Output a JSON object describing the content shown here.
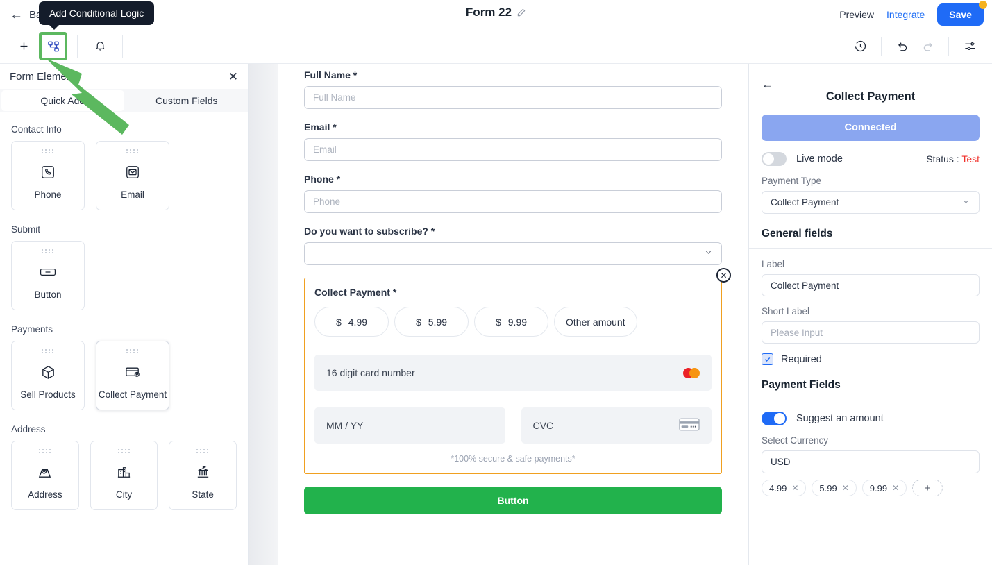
{
  "header": {
    "back_label": "Back",
    "form_title": "Form 22",
    "pencil_icon": "pencil-icon",
    "preview_label": "Preview",
    "integrate_label": "Integrate",
    "save_label": "Save",
    "save_badge_color": "#f5b220",
    "save_button_color": "#1f6bf6",
    "integrate_link_color": "#1a6bf5"
  },
  "toolbar": {
    "add_icon": "plus-icon",
    "conditional_logic_icon": "conditional-logic-icon",
    "notification_icon": "bell-icon",
    "history_icon": "history-clock-icon",
    "undo_icon": "undo-icon",
    "redo_icon": "redo-icon",
    "settings_icon": "sliders-settings-icon",
    "highlight_color": "#5cb85f"
  },
  "tooltip": {
    "text": "Add Conditional Logic"
  },
  "left_panel": {
    "title": "Form Elements",
    "close_icon": "close-icon",
    "tabs": [
      {
        "label": "Quick Add",
        "active": true
      },
      {
        "label": "Custom Fields",
        "active": false
      }
    ],
    "groups": [
      {
        "title": "Contact Info",
        "items": [
          {
            "label": "Phone",
            "icon": "phone-icon"
          },
          {
            "label": "Email",
            "icon": "envelope-icon"
          }
        ]
      },
      {
        "title": "Submit",
        "items": [
          {
            "label": "Button",
            "icon": "button-icon"
          }
        ]
      },
      {
        "title": "Payments",
        "items": [
          {
            "label": "Sell Products",
            "icon": "box-package-icon"
          },
          {
            "label": "Collect Payment",
            "icon": "credit-card-shield-icon",
            "selected": true
          }
        ]
      },
      {
        "title": "Address",
        "items": [
          {
            "label": "Address",
            "icon": "map-pin-icon"
          },
          {
            "label": "City",
            "icon": "city-building-icon"
          },
          {
            "label": "State",
            "icon": "bank-landmark-icon"
          }
        ]
      }
    ]
  },
  "canvas": {
    "fields": [
      {
        "label": "Full Name *",
        "placeholder": "Full Name",
        "type": "text"
      },
      {
        "label": "Email *",
        "placeholder": "Email",
        "type": "text"
      },
      {
        "label": "Phone *",
        "placeholder": "Phone",
        "type": "text"
      },
      {
        "label": "Do you want to subscribe? *",
        "placeholder": "",
        "type": "select"
      }
    ],
    "payment_block": {
      "label": "Collect Payment *",
      "close_icon": "remove-block-icon",
      "border_color": "#f0a020",
      "amounts": [
        {
          "currency": "$",
          "value": "4.99"
        },
        {
          "currency": "$",
          "value": "5.99"
        },
        {
          "currency": "$",
          "value": "9.99"
        }
      ],
      "other_amount_label": "Other amount",
      "card_number_placeholder": "16 digit card number",
      "card_brand_icon": "mastercard-logo",
      "expiry_placeholder": "MM / YY",
      "cvc_placeholder": "CVC",
      "cvc_icon": "credit-card-icon",
      "secure_note": "*100% secure & safe payments*"
    },
    "submit_button": {
      "label": "Button",
      "color": "#22b24c"
    }
  },
  "right_panel": {
    "back_icon": "back-arrow-icon",
    "title": "Collect Payment",
    "connected_label": "Connected",
    "connected_color": "#8aa6f0",
    "live_mode_label": "Live mode",
    "live_mode_on": false,
    "status_prefix": "Status :",
    "status_value": "Test",
    "status_color": "#f0312b",
    "payment_type_label": "Payment Type",
    "payment_type_value": "Collect Payment",
    "general_fields_title": "General fields",
    "label_field_label": "Label",
    "label_field_value": "Collect Payment",
    "short_label_label": "Short Label",
    "short_label_placeholder": "Please Input",
    "required_label": "Required",
    "required_checked": true,
    "payment_fields_title": "Payment Fields",
    "suggest_amount_label": "Suggest an amount",
    "suggest_amount_on": true,
    "select_currency_label": "Select Currency",
    "currency_value": "USD",
    "amount_tags": [
      "4.99",
      "5.99",
      "9.99"
    ],
    "add_tag_label": "+",
    "tag_remove_icon": "close-small-icon"
  }
}
